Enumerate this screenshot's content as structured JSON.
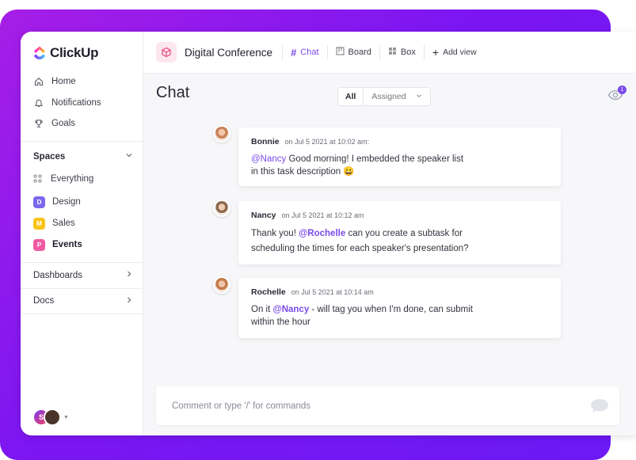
{
  "app": {
    "name": "ClickUp"
  },
  "sidebar": {
    "nav": [
      {
        "label": "Home",
        "icon": "home-icon"
      },
      {
        "label": "Notifications",
        "icon": "bell-icon"
      },
      {
        "label": "Goals",
        "icon": "trophy-icon"
      }
    ],
    "spaces_label": "Spaces",
    "everything_label": "Everything",
    "spaces": [
      {
        "letter": "D",
        "label": "Design",
        "color": "#7b68ee"
      },
      {
        "letter": "M",
        "label": "Sales",
        "color": "#f8c41a"
      },
      {
        "letter": "P",
        "label": "Events",
        "color": "#f15aa3"
      }
    ],
    "dashboards_label": "Dashboards",
    "docs_label": "Docs",
    "user_initial": "S"
  },
  "header": {
    "project_title": "Digital Conference",
    "views": [
      {
        "label": "Chat",
        "icon": "hash-icon"
      },
      {
        "label": "Board",
        "icon": "board-icon"
      },
      {
        "label": "Box",
        "icon": "box-icon"
      }
    ],
    "add_view": "Add view"
  },
  "chat": {
    "title": "Chat",
    "filter_all": "All",
    "filter_assigned": "Assigned",
    "watchers_count": "1",
    "messages": [
      {
        "name": "Bonnie",
        "time": "on Jul 5 2021 at 10:02 am:",
        "mention": "@Nancy",
        "text1": " Good morning! I embedded the speaker list",
        "text2": "in this task description 😀"
      },
      {
        "name": "Nancy",
        "time": "on Jul 5 2021 at 10:12 am",
        "pre": "Thank you! ",
        "mention": "@Rochelle",
        "text1": " can you create a subtask for",
        "text2": "scheduling the times for each speaker's presentation?"
      },
      {
        "name": "Rochelle",
        "time": "on Jul 5 2021 at 10:14 am",
        "pre": "On it ",
        "mention": "@Nancy",
        "text1": " - will tag you when I'm done, can submit",
        "text2": "within the hour"
      }
    ],
    "composer_placeholder": "Comment or type '/' for commands"
  },
  "colors": {
    "accent": "#7b4bea",
    "gradient_start": "#a61ee6",
    "gradient_end": "#6b19f5"
  }
}
